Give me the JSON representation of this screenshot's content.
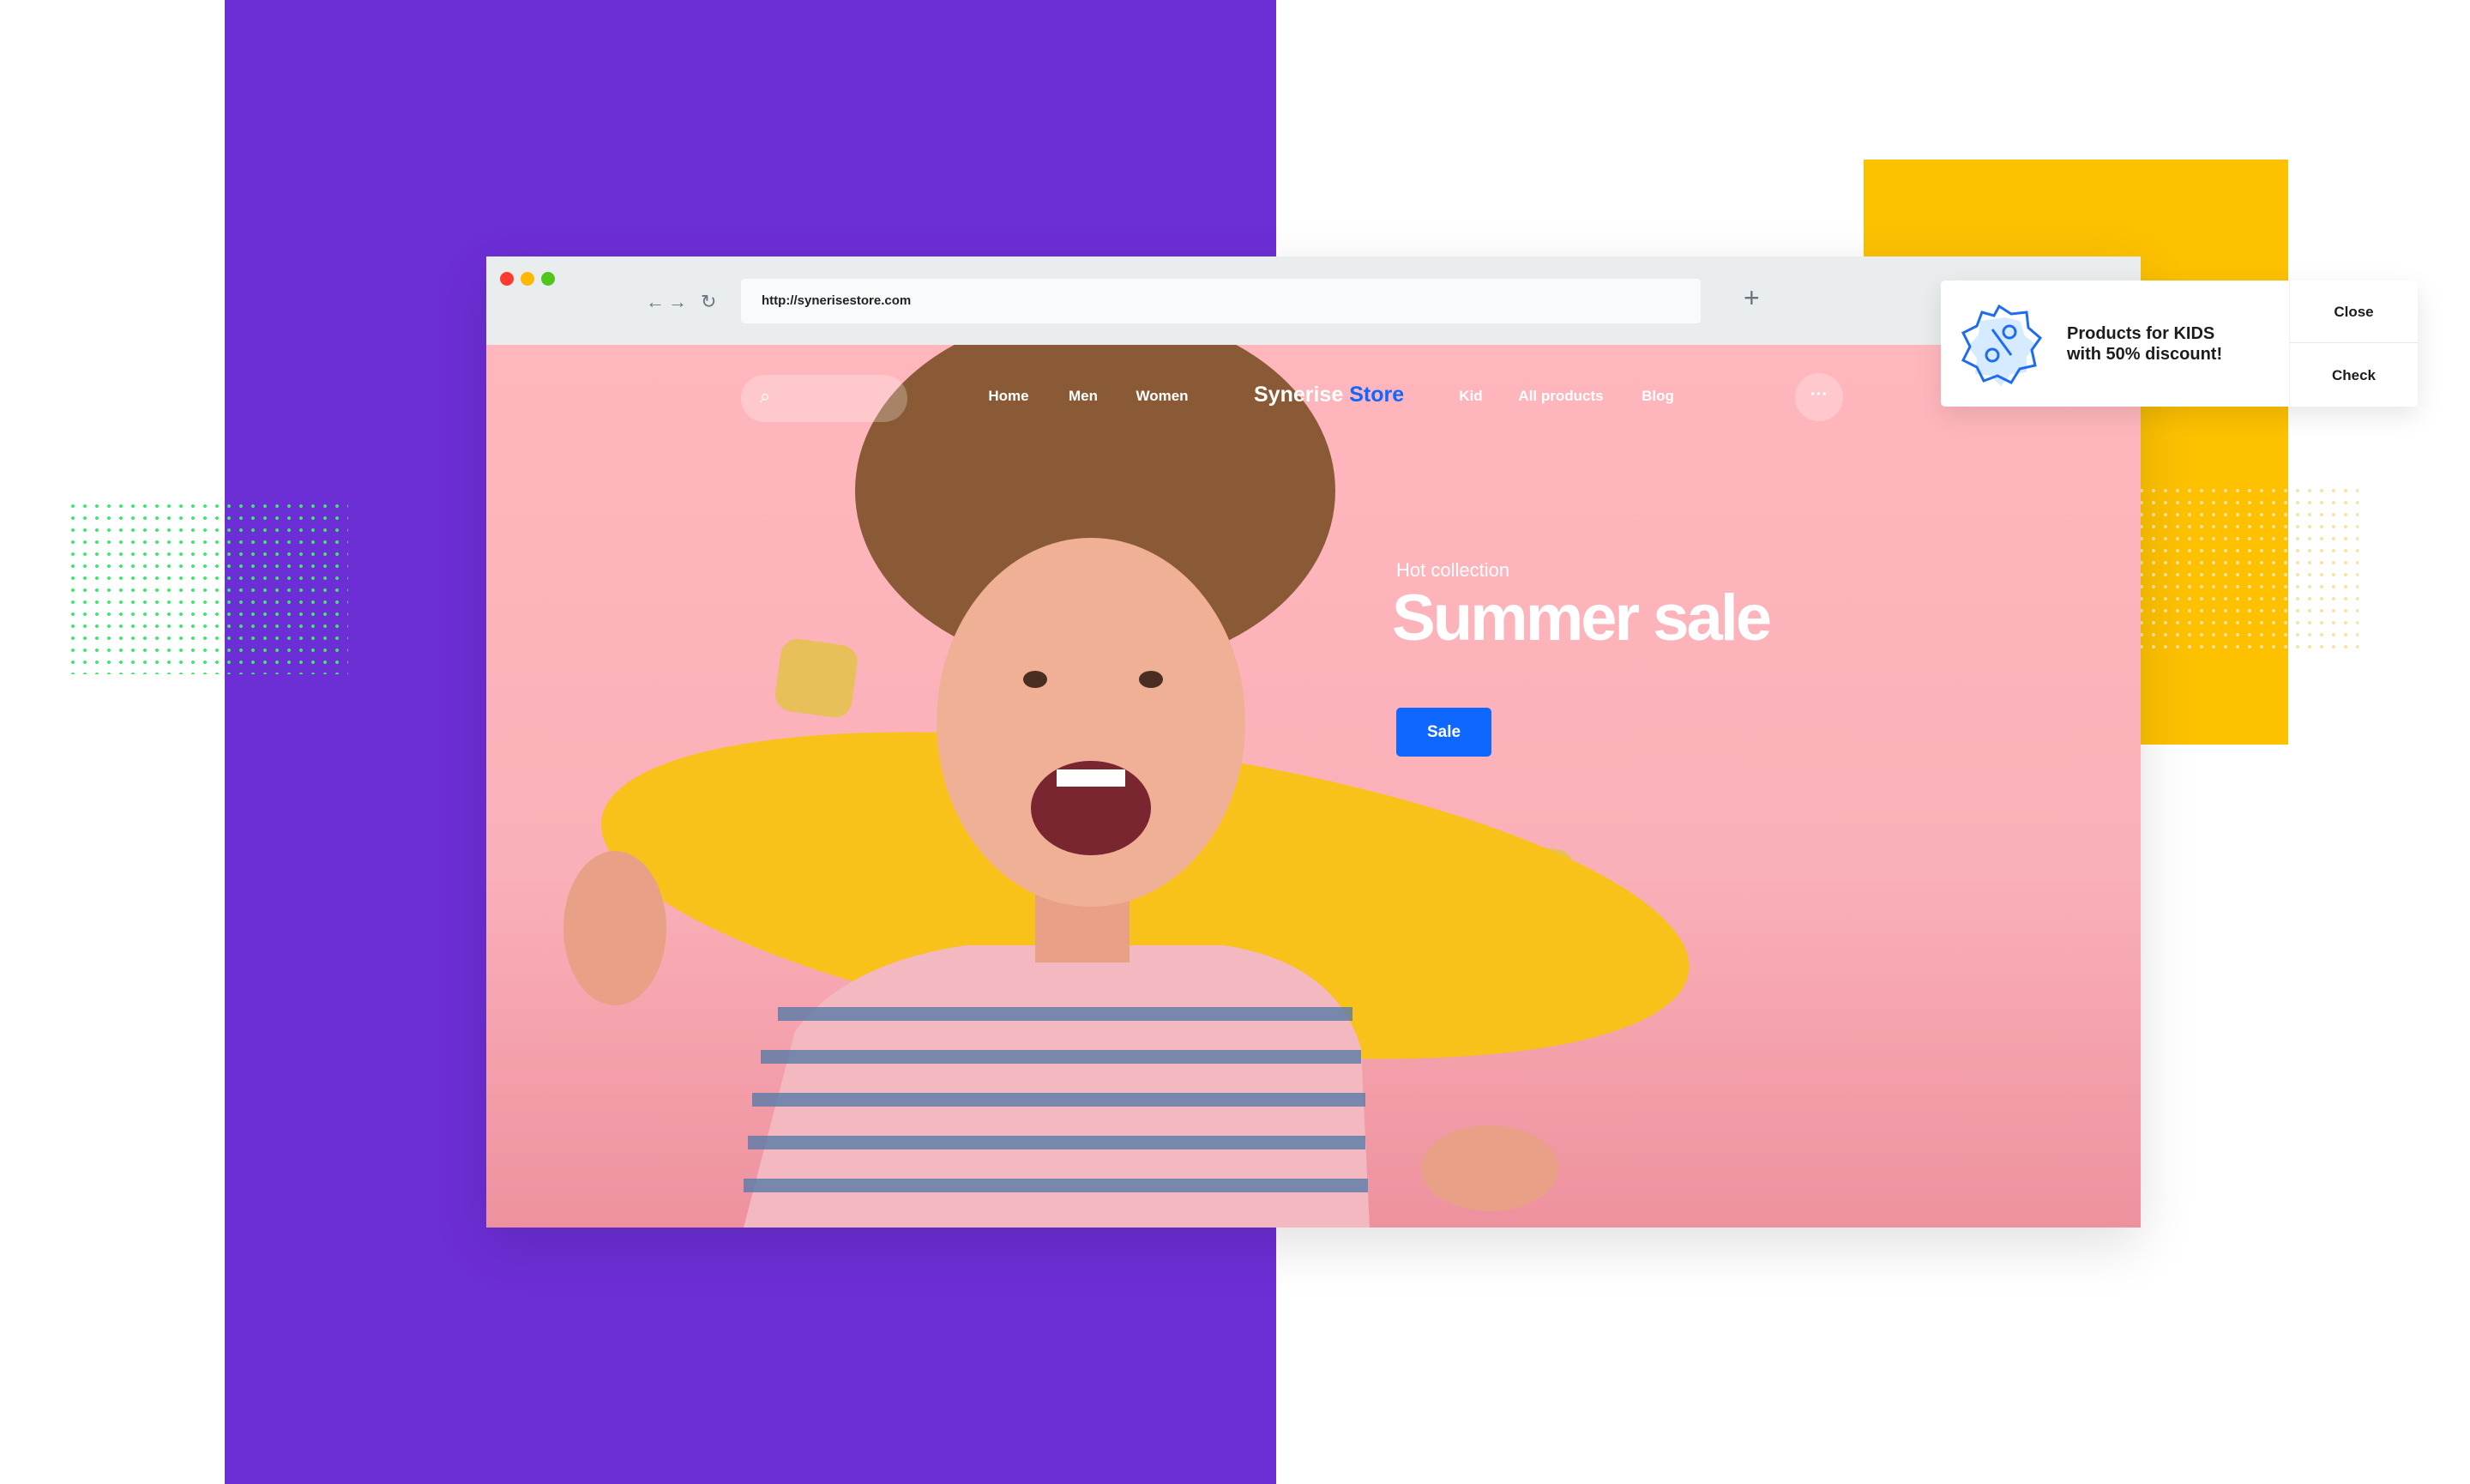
{
  "colors": {
    "purple": "#6c2ed5",
    "yellow": "#fdc100",
    "accent": "#0e68ff",
    "hero_pink": "#ffb6bc"
  },
  "browser": {
    "url": "http://synerisestore.com",
    "back_icon": "arrow-left-icon",
    "forward_icon": "arrow-right-icon",
    "reload_icon": "reload-icon",
    "new_tab_icon": "plus-icon",
    "back": "←",
    "forward": "→",
    "reload": "↻",
    "plus": "+"
  },
  "store": {
    "nav": [
      {
        "label": "Home"
      },
      {
        "label": "Men"
      },
      {
        "label": "Women"
      },
      {
        "label": "Kid"
      },
      {
        "label": "All products"
      },
      {
        "label": "Blog"
      }
    ],
    "logo": {
      "first": "Synerise",
      "second": "Store"
    },
    "search_icon": "⌕",
    "more_icon": "···"
  },
  "hero": {
    "eyebrow": "Hot collection",
    "title": "Summer sale",
    "button": "Sale"
  },
  "popup": {
    "line1": "Products for KIDS",
    "line2": "with 50% discount!",
    "close": "Close",
    "check": "Check",
    "icon": "discount-badge-icon"
  }
}
